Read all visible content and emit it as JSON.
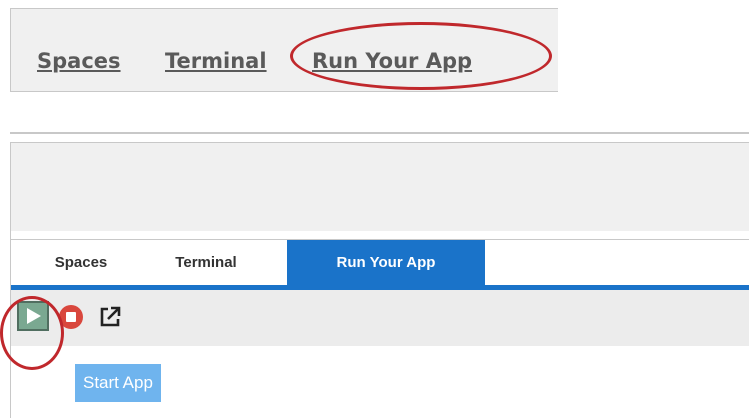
{
  "top_menu": {
    "items": [
      {
        "label": "Spaces"
      },
      {
        "label": "Terminal"
      },
      {
        "label": "Run Your App"
      }
    ]
  },
  "app": {
    "tabs": [
      {
        "label": "Spaces",
        "active": false
      },
      {
        "label": "Terminal",
        "active": false
      },
      {
        "label": "Run Your App",
        "active": true
      }
    ],
    "toolbar": {
      "buttons": [
        {
          "icon": "play-icon"
        },
        {
          "icon": "stop-icon"
        },
        {
          "icon": "external-link-icon"
        }
      ]
    },
    "tooltip": "Start App"
  },
  "colors": {
    "accent": "#1a73c9",
    "callout": "#c0282c",
    "tooltip_bg": "#6fb4ee",
    "play_bg": "#7aa891",
    "stop": "#d9473d"
  }
}
